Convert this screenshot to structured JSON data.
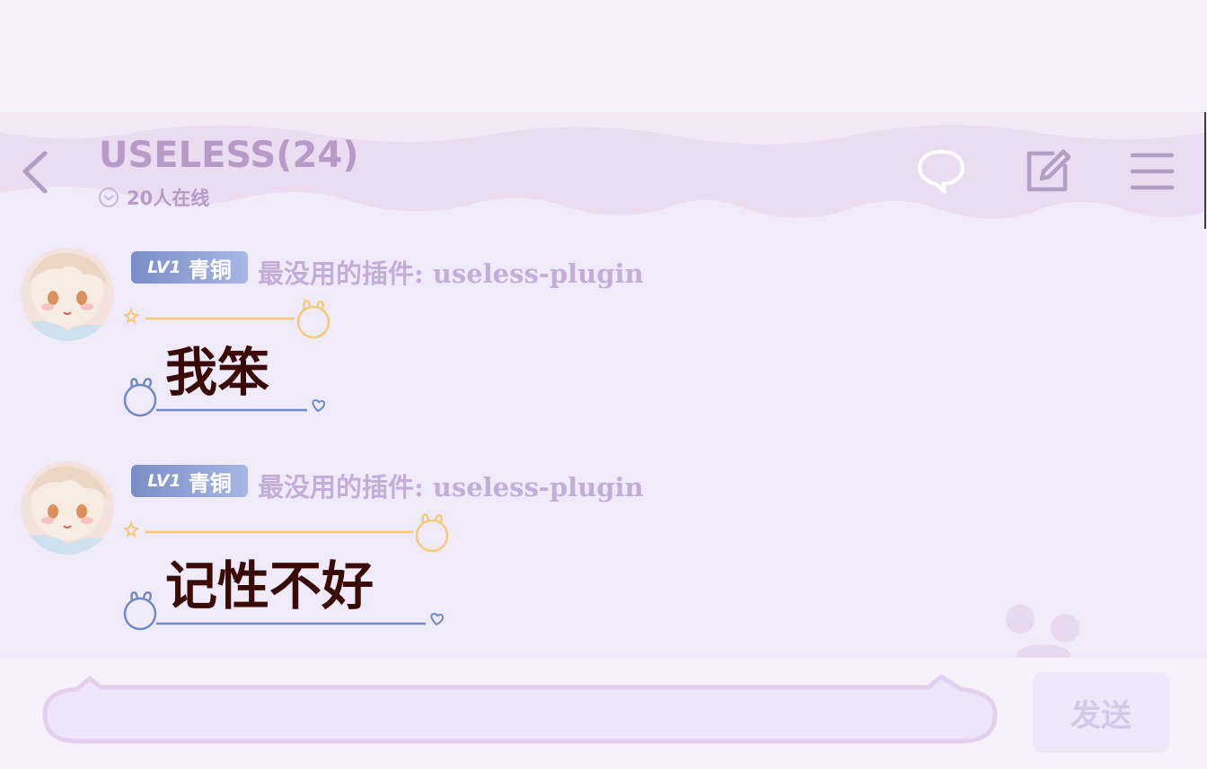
{
  "header": {
    "title": "USELESS(24)",
    "online_count": "20人在线",
    "icons": [
      "back-arrow-icon",
      "chat-bubble-icon",
      "edit-icon",
      "menu-icon"
    ]
  },
  "messages": [
    {
      "level_label": "LV1",
      "level_rank": "青铜",
      "sender": "最没用的插件: useless-plugin",
      "text": "我笨"
    },
    {
      "level_label": "LV1",
      "level_rank": "青铜",
      "sender": "最没用的插件: useless-plugin",
      "text": "记性不好"
    }
  ],
  "composer": {
    "input_value": "",
    "send_label": "发送"
  },
  "colors": {
    "background": "#f0ebfb",
    "header_text": "#b79ac6",
    "message_text": "#3a0a06",
    "level_badge": "#8c9fd4",
    "bubble_top_line": "#f7c878",
    "bubble_bottom_line": "#6f8ac6"
  }
}
